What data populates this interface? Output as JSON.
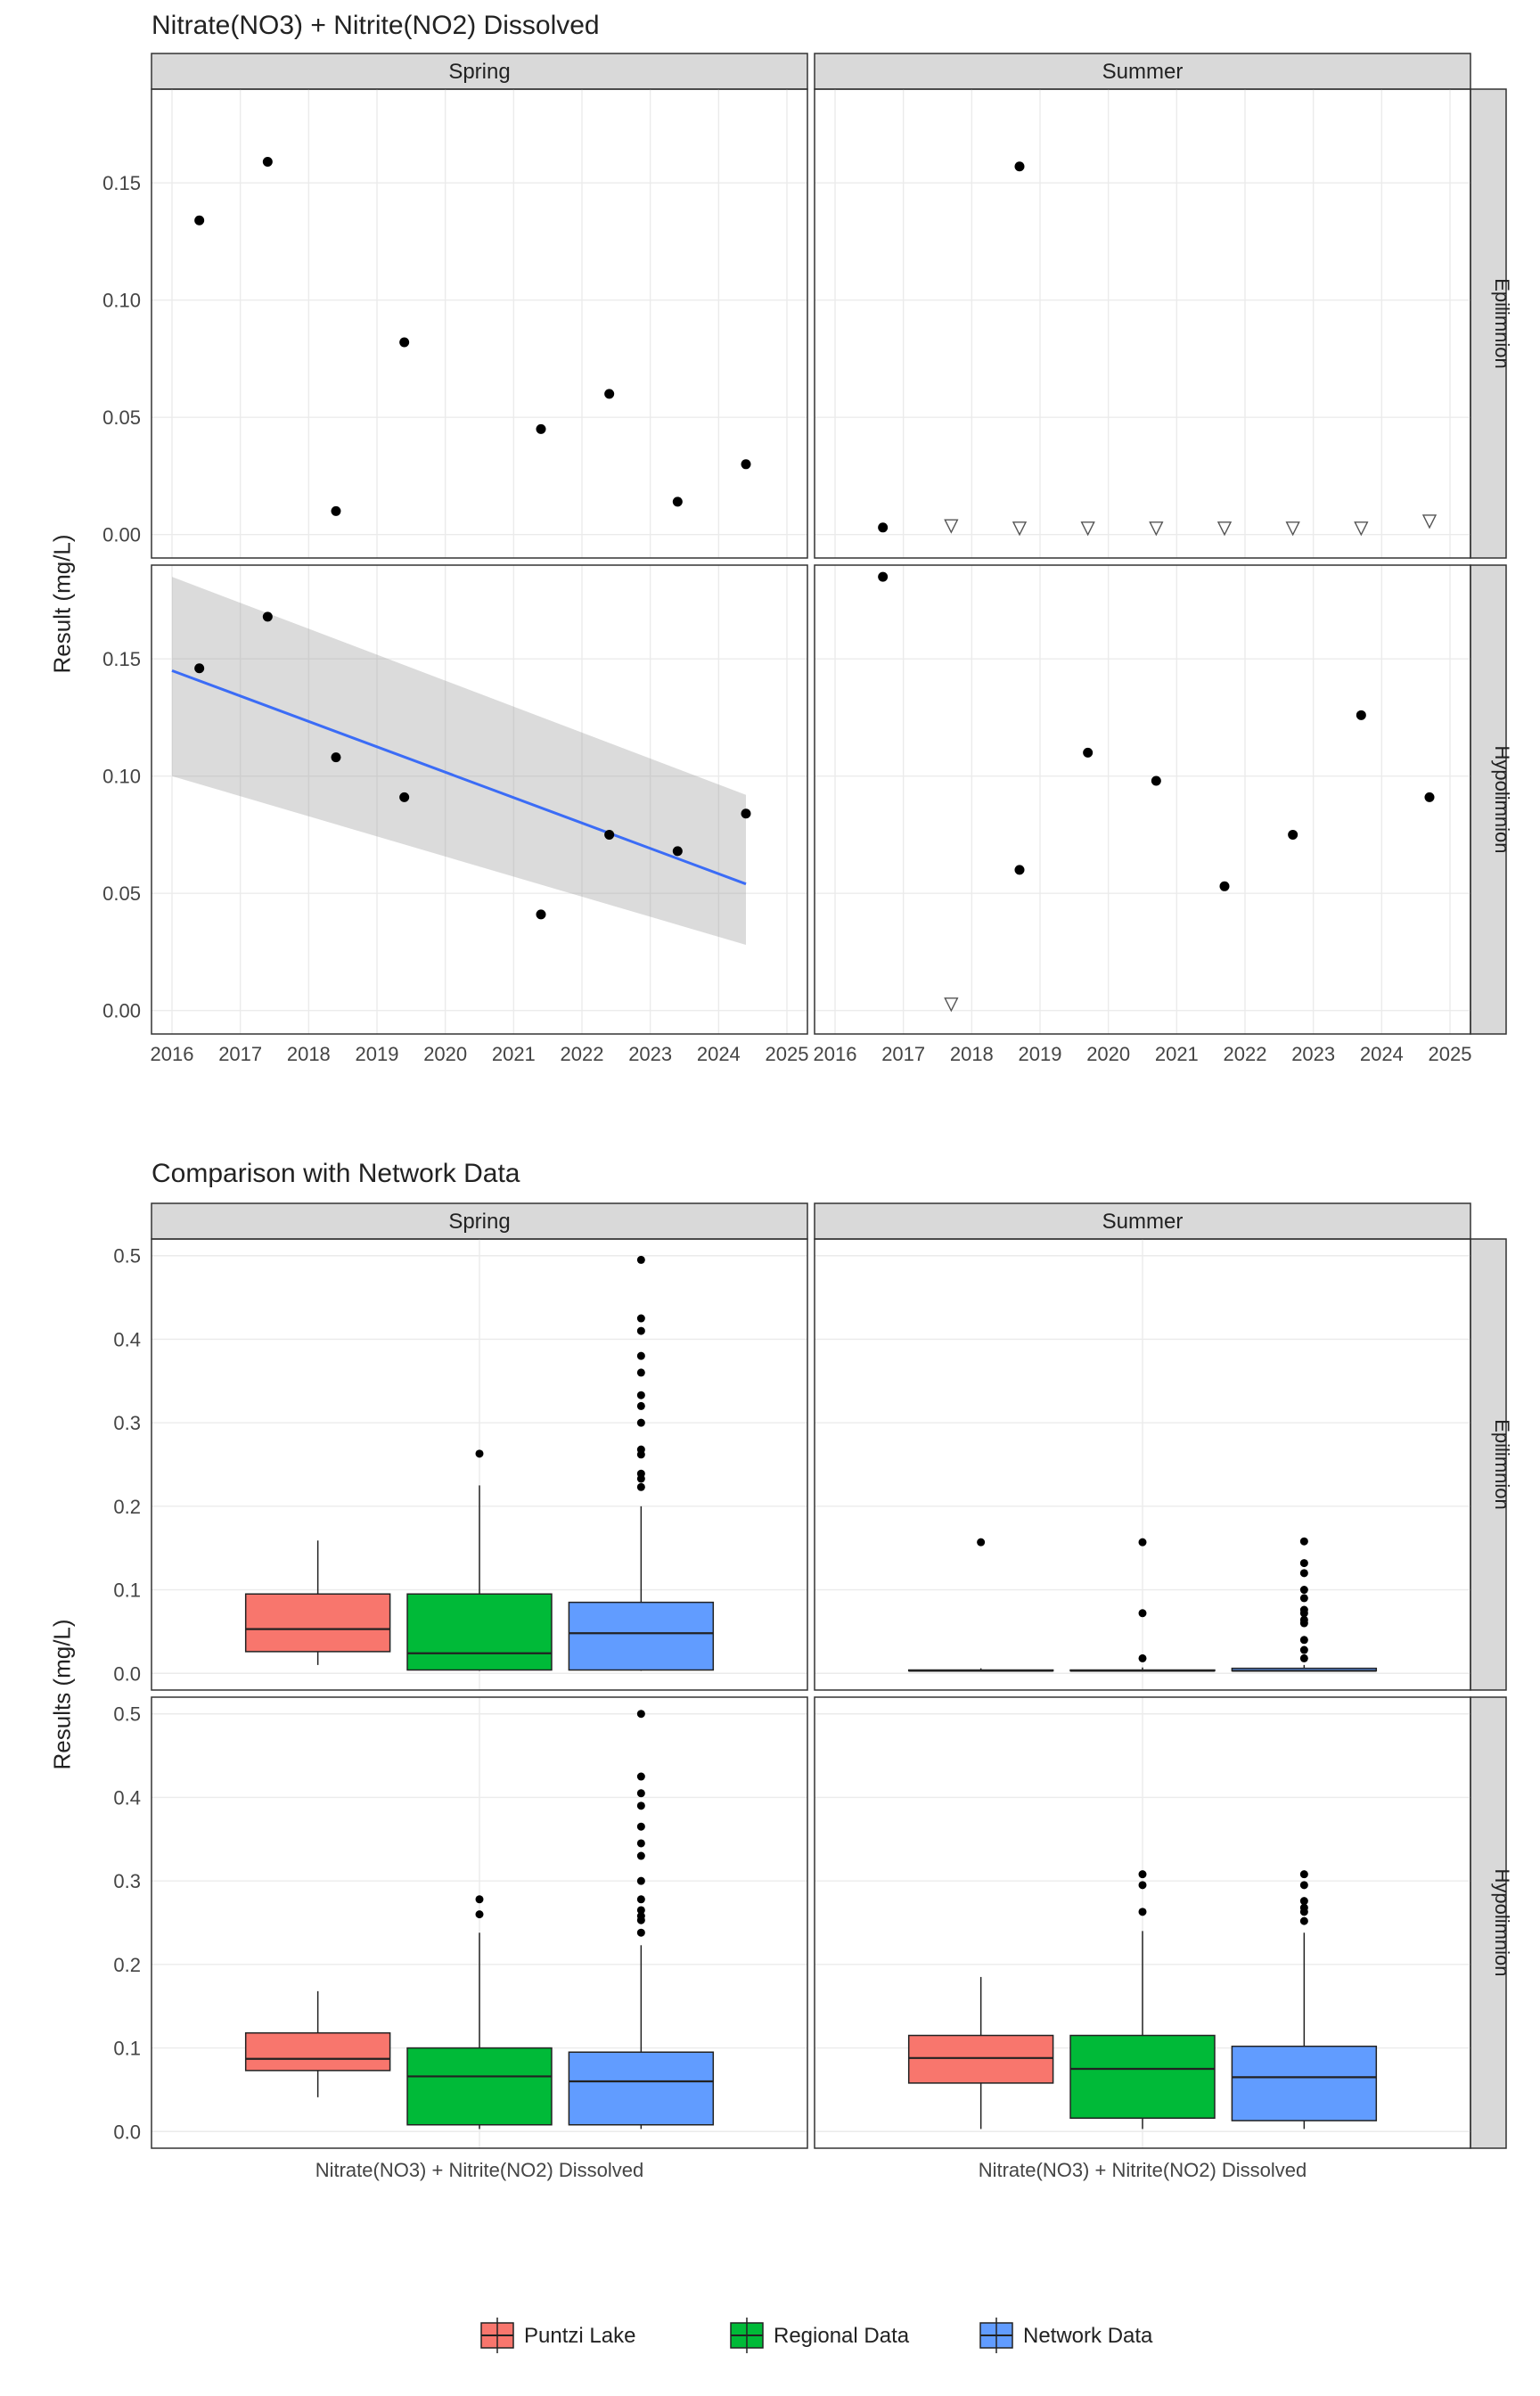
{
  "titles": {
    "top": "Nitrate(NO3) + Nitrite(NO2) Dissolved",
    "bottom": "Comparison with Network Data"
  },
  "axes": {
    "top_y": "Result (mg/L)",
    "bottom_y": "Results (mg/L)"
  },
  "facets": {
    "cols": [
      "Spring",
      "Summer"
    ],
    "rows": [
      "Epilimnion",
      "Hypolimnion"
    ]
  },
  "legend": {
    "items": [
      {
        "label": "Puntzi Lake",
        "fill": "#F8766D"
      },
      {
        "label": "Regional Data",
        "fill": "#00BA38"
      },
      {
        "label": "Network Data",
        "fill": "#619CFF"
      }
    ]
  },
  "chart_data": [
    {
      "type": "scatter",
      "title": "Nitrate(NO3) + Nitrite(NO2) Dissolved",
      "xlabel": "",
      "ylabel": "Result (mg/L)",
      "x_ticks": [
        2016,
        2017,
        2018,
        2019,
        2020,
        2021,
        2022,
        2023,
        2024,
        2025
      ],
      "y_ticks": [
        0.0,
        0.05,
        0.1,
        0.15
      ],
      "y_lim": [
        -0.01,
        0.19
      ],
      "panels": [
        {
          "col": "Spring",
          "row": "Epilimnion",
          "points": [
            {
              "x": 2016.4,
              "y": 0.134
            },
            {
              "x": 2017.4,
              "y": 0.159
            },
            {
              "x": 2018.4,
              "y": 0.01
            },
            {
              "x": 2019.4,
              "y": 0.082
            },
            {
              "x": 2021.4,
              "y": 0.045
            },
            {
              "x": 2022.4,
              "y": 0.06
            },
            {
              "x": 2023.4,
              "y": 0.014
            },
            {
              "x": 2024.4,
              "y": 0.03
            }
          ]
        },
        {
          "col": "Summer",
          "row": "Epilimnion",
          "points": [
            {
              "x": 2016.7,
              "y": 0.003
            },
            {
              "x": 2018.7,
              "y": 0.157
            }
          ],
          "censored": [
            {
              "x": 2017.7,
              "y": 0.004
            },
            {
              "x": 2018.7,
              "y": 0.003
            },
            {
              "x": 2019.7,
              "y": 0.003
            },
            {
              "x": 2020.7,
              "y": 0.003
            },
            {
              "x": 2021.7,
              "y": 0.003
            },
            {
              "x": 2022.7,
              "y": 0.003
            },
            {
              "x": 2023.7,
              "y": 0.003
            },
            {
              "x": 2024.7,
              "y": 0.006
            }
          ]
        },
        {
          "col": "Spring",
          "row": "Hypolimnion",
          "points": [
            {
              "x": 2016.4,
              "y": 0.146
            },
            {
              "x": 2017.4,
              "y": 0.168
            },
            {
              "x": 2018.4,
              "y": 0.108
            },
            {
              "x": 2019.4,
              "y": 0.091
            },
            {
              "x": 2021.4,
              "y": 0.041
            },
            {
              "x": 2022.4,
              "y": 0.075
            },
            {
              "x": 2023.4,
              "y": 0.068
            },
            {
              "x": 2024.4,
              "y": 0.084
            }
          ],
          "trend": {
            "x": [
              2016,
              2024.4
            ],
            "y": [
              0.145,
              0.054
            ],
            "se": [
              [
                2016,
                0.1,
                0.185
              ],
              [
                2024.4,
                0.028,
                0.092
              ]
            ]
          }
        },
        {
          "col": "Summer",
          "row": "Hypolimnion",
          "points": [
            {
              "x": 2016.7,
              "y": 0.185
            },
            {
              "x": 2018.7,
              "y": 0.06
            },
            {
              "x": 2019.7,
              "y": 0.11
            },
            {
              "x": 2020.7,
              "y": 0.098
            },
            {
              "x": 2021.7,
              "y": 0.053
            },
            {
              "x": 2022.7,
              "y": 0.075
            },
            {
              "x": 2023.7,
              "y": 0.126
            },
            {
              "x": 2024.7,
              "y": 0.091
            }
          ],
          "censored": [
            {
              "x": 2017.7,
              "y": 0.003
            }
          ]
        }
      ]
    },
    {
      "type": "boxplot",
      "title": "Comparison with Network Data",
      "xlabel": "Nitrate(NO3) + Nitrite(NO2) Dissolved",
      "ylabel": "Results (mg/L)",
      "y_ticks": [
        0.0,
        0.1,
        0.2,
        0.3,
        0.4,
        0.5
      ],
      "y_lim": [
        -0.02,
        0.52
      ],
      "groups": [
        "Puntzi Lake",
        "Regional Data",
        "Network Data"
      ],
      "panels": [
        {
          "col": "Spring",
          "row": "Epilimnion",
          "boxes": [
            {
              "group": "Puntzi Lake",
              "min": 0.01,
              "q1": 0.026,
              "med": 0.053,
              "q3": 0.095,
              "max": 0.159,
              "outliers": []
            },
            {
              "group": "Regional Data",
              "min": 0.003,
              "q1": 0.004,
              "med": 0.024,
              "q3": 0.095,
              "max": 0.225,
              "outliers": [
                0.263
              ]
            },
            {
              "group": "Network Data",
              "min": 0.003,
              "q1": 0.004,
              "med": 0.048,
              "q3": 0.085,
              "max": 0.2,
              "outliers": [
                0.223,
                0.233,
                0.239,
                0.262,
                0.268,
                0.3,
                0.32,
                0.333,
                0.36,
                0.38,
                0.41,
                0.425,
                0.495
              ]
            }
          ]
        },
        {
          "col": "Summer",
          "row": "Epilimnion",
          "boxes": [
            {
              "group": "Puntzi Lake",
              "min": 0.002,
              "q1": 0.003,
              "med": 0.003,
              "q3": 0.004,
              "max": 0.006,
              "outliers": [
                0.157
              ]
            },
            {
              "group": "Regional Data",
              "min": 0.002,
              "q1": 0.003,
              "med": 0.003,
              "q3": 0.004,
              "max": 0.007,
              "outliers": [
                0.018,
                0.072,
                0.157
              ]
            },
            {
              "group": "Network Data",
              "min": 0.002,
              "q1": 0.003,
              "med": 0.003,
              "q3": 0.006,
              "max": 0.01,
              "outliers": [
                0.018,
                0.028,
                0.04,
                0.06,
                0.064,
                0.072,
                0.076,
                0.09,
                0.1,
                0.12,
                0.132,
                0.158
              ]
            }
          ]
        },
        {
          "col": "Spring",
          "row": "Hypolimnion",
          "boxes": [
            {
              "group": "Puntzi Lake",
              "min": 0.041,
              "q1": 0.073,
              "med": 0.087,
              "q3": 0.118,
              "max": 0.168,
              "outliers": []
            },
            {
              "group": "Regional Data",
              "min": 0.003,
              "q1": 0.008,
              "med": 0.066,
              "q3": 0.1,
              "max": 0.238,
              "outliers": [
                0.26,
                0.278
              ]
            },
            {
              "group": "Network Data",
              "min": 0.003,
              "q1": 0.008,
              "med": 0.06,
              "q3": 0.095,
              "max": 0.223,
              "outliers": [
                0.238,
                0.253,
                0.258,
                0.265,
                0.278,
                0.3,
                0.33,
                0.345,
                0.365,
                0.39,
                0.405,
                0.425,
                0.5
              ]
            }
          ]
        },
        {
          "col": "Summer",
          "row": "Hypolimnion",
          "boxes": [
            {
              "group": "Puntzi Lake",
              "min": 0.003,
              "q1": 0.058,
              "med": 0.088,
              "q3": 0.115,
              "max": 0.185,
              "outliers": []
            },
            {
              "group": "Regional Data",
              "min": 0.003,
              "q1": 0.016,
              "med": 0.075,
              "q3": 0.115,
              "max": 0.24,
              "outliers": [
                0.263,
                0.295,
                0.308
              ]
            },
            {
              "group": "Network Data",
              "min": 0.003,
              "q1": 0.013,
              "med": 0.065,
              "q3": 0.102,
              "max": 0.238,
              "outliers": [
                0.252,
                0.263,
                0.268,
                0.276,
                0.295,
                0.308
              ]
            }
          ]
        }
      ]
    }
  ]
}
